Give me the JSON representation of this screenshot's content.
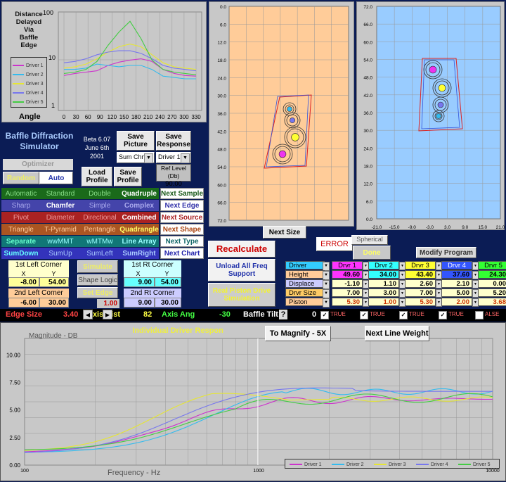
{
  "polar": {
    "title_lines": [
      "Distance",
      "Delayed",
      "Via",
      "Baffle",
      "Edge"
    ],
    "ytick_top": "100",
    "yticks_side": [
      "10",
      "1"
    ],
    "xlabel": "Angle",
    "xticks": [
      "0",
      "30",
      "60",
      "90",
      "120",
      "150",
      "180",
      "210",
      "240",
      "270",
      "300",
      "330"
    ],
    "legend": [
      "Driver 1",
      "Driver 2",
      "Driver 3",
      "Driver 4",
      "Driver 5"
    ]
  },
  "front_view": {
    "y_ticks": [
      "0.0",
      "6.0",
      "12.0",
      "18.0",
      "24.0",
      "30.0",
      "36.0",
      "42.0",
      "48.0",
      "54.0",
      "60.0",
      "66.0",
      "72.0"
    ],
    "next_size_label": "Next Size"
  },
  "side_view": {
    "y_ticks": [
      "72.0",
      "66.0",
      "60.0",
      "54.0",
      "48.0",
      "42.0",
      "36.0",
      "30.0",
      "24.0",
      "18.0",
      "12.0",
      "6.0",
      "0.0"
    ],
    "x_ticks": [
      "-21.0",
      "-15.0",
      "-9.0",
      "-3.0",
      "3.0",
      "9.0",
      "15.0",
      "21.0"
    ]
  },
  "app": {
    "title": "Baffle Diffraction Simulator",
    "version": "Beta 6.07",
    "date": "June 6th",
    "year": "2001",
    "optimizer_label": "Optimizer",
    "random_label": "Random",
    "auto_label": "Auto"
  },
  "buttons": {
    "save_picture": "Save Picture",
    "save_response": "Save Response",
    "sum_chart": "Sum Chrt",
    "driver_select": "Driver 1",
    "ref_level_label": "Ref Level (Db)",
    "ref_level_value": "90.00",
    "load_profile": "Load Profile",
    "save_profile": "Save Profile",
    "recalculate": "Recalculate",
    "unload_all": "Unload All Freq Support",
    "real_piston": "Real Piston Drive Simulation",
    "error": "ERROR",
    "spherical": "Spherical",
    "done": "Done",
    "modify_program": "Modify Program",
    "to_magnify": "To Magnify - 5X",
    "next_line_weight": "Next Line Weight",
    "individual_driver_response": "Individual Driver Respon"
  },
  "shape_grid": [
    [
      "Automatic",
      "Standard",
      "Double",
      "Quadruple",
      "Next Sample"
    ],
    [
      "Sharp",
      "Chamfer",
      "Simple",
      "Complex",
      "Next Edge"
    ],
    [
      "Pivot",
      "Diameter",
      "Directional",
      "Combined",
      "Next Source"
    ],
    [
      "Triangle",
      "T-Pyramid",
      "Pentangle",
      "Quadrangle",
      "Next Shape"
    ],
    [
      "Separate",
      "wwMMT",
      "wMTMw",
      "Line Array",
      "Next Type"
    ],
    [
      "SumDown",
      "SumUp",
      "SumLeft",
      "SumRight",
      "Next Chart"
    ]
  ],
  "corners": {
    "first_left": "1st Left Corner",
    "first_right": "1st Rt Corner",
    "second_left": "2nd Left Corner",
    "second_right": "2nd Rt Corner",
    "x": "X",
    "y": "Y",
    "fl_x": "-8.00",
    "fl_y": "54.00",
    "fr_x": "9.00",
    "fr_y": "54.00",
    "sl_x": "-6.00",
    "sl_y": "30.00",
    "sr_x": "9.00",
    "sr_y": "30.00",
    "simulate": "Simulate",
    "shape_logic": "Shape Logic",
    "set_edge": "Set Edge",
    "edge_val": "1.00"
  },
  "driver_table": {
    "rows": [
      "Driver",
      "Height",
      "Displace",
      "Drvr Size",
      "Piston"
    ],
    "cols": [
      "Drvr 1",
      "Drvr 2",
      "Drvr 3",
      "Drvr 4",
      "Drvr 5"
    ],
    "height": [
      "49.60",
      "34.00",
      "43.40",
      "37.60",
      "24.30"
    ],
    "displace": [
      "-1.10",
      "1.10",
      "2.60",
      "2.10",
      "0.00"
    ],
    "size": [
      "7.00",
      "3.00",
      "7.00",
      "5.00",
      "5.20"
    ],
    "piston": [
      "5.30",
      "1.00",
      "5.30",
      "2.00",
      "3.68"
    ],
    "col_colors": [
      "#ff33ff",
      "#33ffff",
      "#ffff33",
      "#3355ff",
      "#33ff33"
    ]
  },
  "status_bar": {
    "edge_size_label": "Edge Size",
    "edge_size_value": "3.40",
    "axis_dist_label": "Axis Dist",
    "axis_dist_value": "82",
    "axis_ang_label": "Axis Ang",
    "axis_ang_value": "-30",
    "baffle_tilt_label": "Baffle Tilt",
    "baffle_tilt_value": "0",
    "question": "?",
    "checks": [
      "TRUE",
      "TRUE",
      "TRUE",
      "TRUE",
      "ALSE"
    ]
  },
  "response": {
    "ylabel": "Magnitude  -  DB",
    "yticks": [
      "10.00",
      "7.50",
      "5.00",
      "2.50",
      "0.00"
    ],
    "xlabel": "Frequency  -  Hz",
    "xticks": [
      "100",
      "1000",
      "10000"
    ],
    "legend": [
      "Driver 1",
      "Driver 2",
      "Driver 3",
      "Driver 4",
      "Driver 5"
    ]
  },
  "colors": {
    "driver1": "#cc33cc",
    "driver2": "#33bbee",
    "driver3": "#e6e633",
    "driver4": "#7777ee",
    "driver5": "#44cc44"
  }
}
